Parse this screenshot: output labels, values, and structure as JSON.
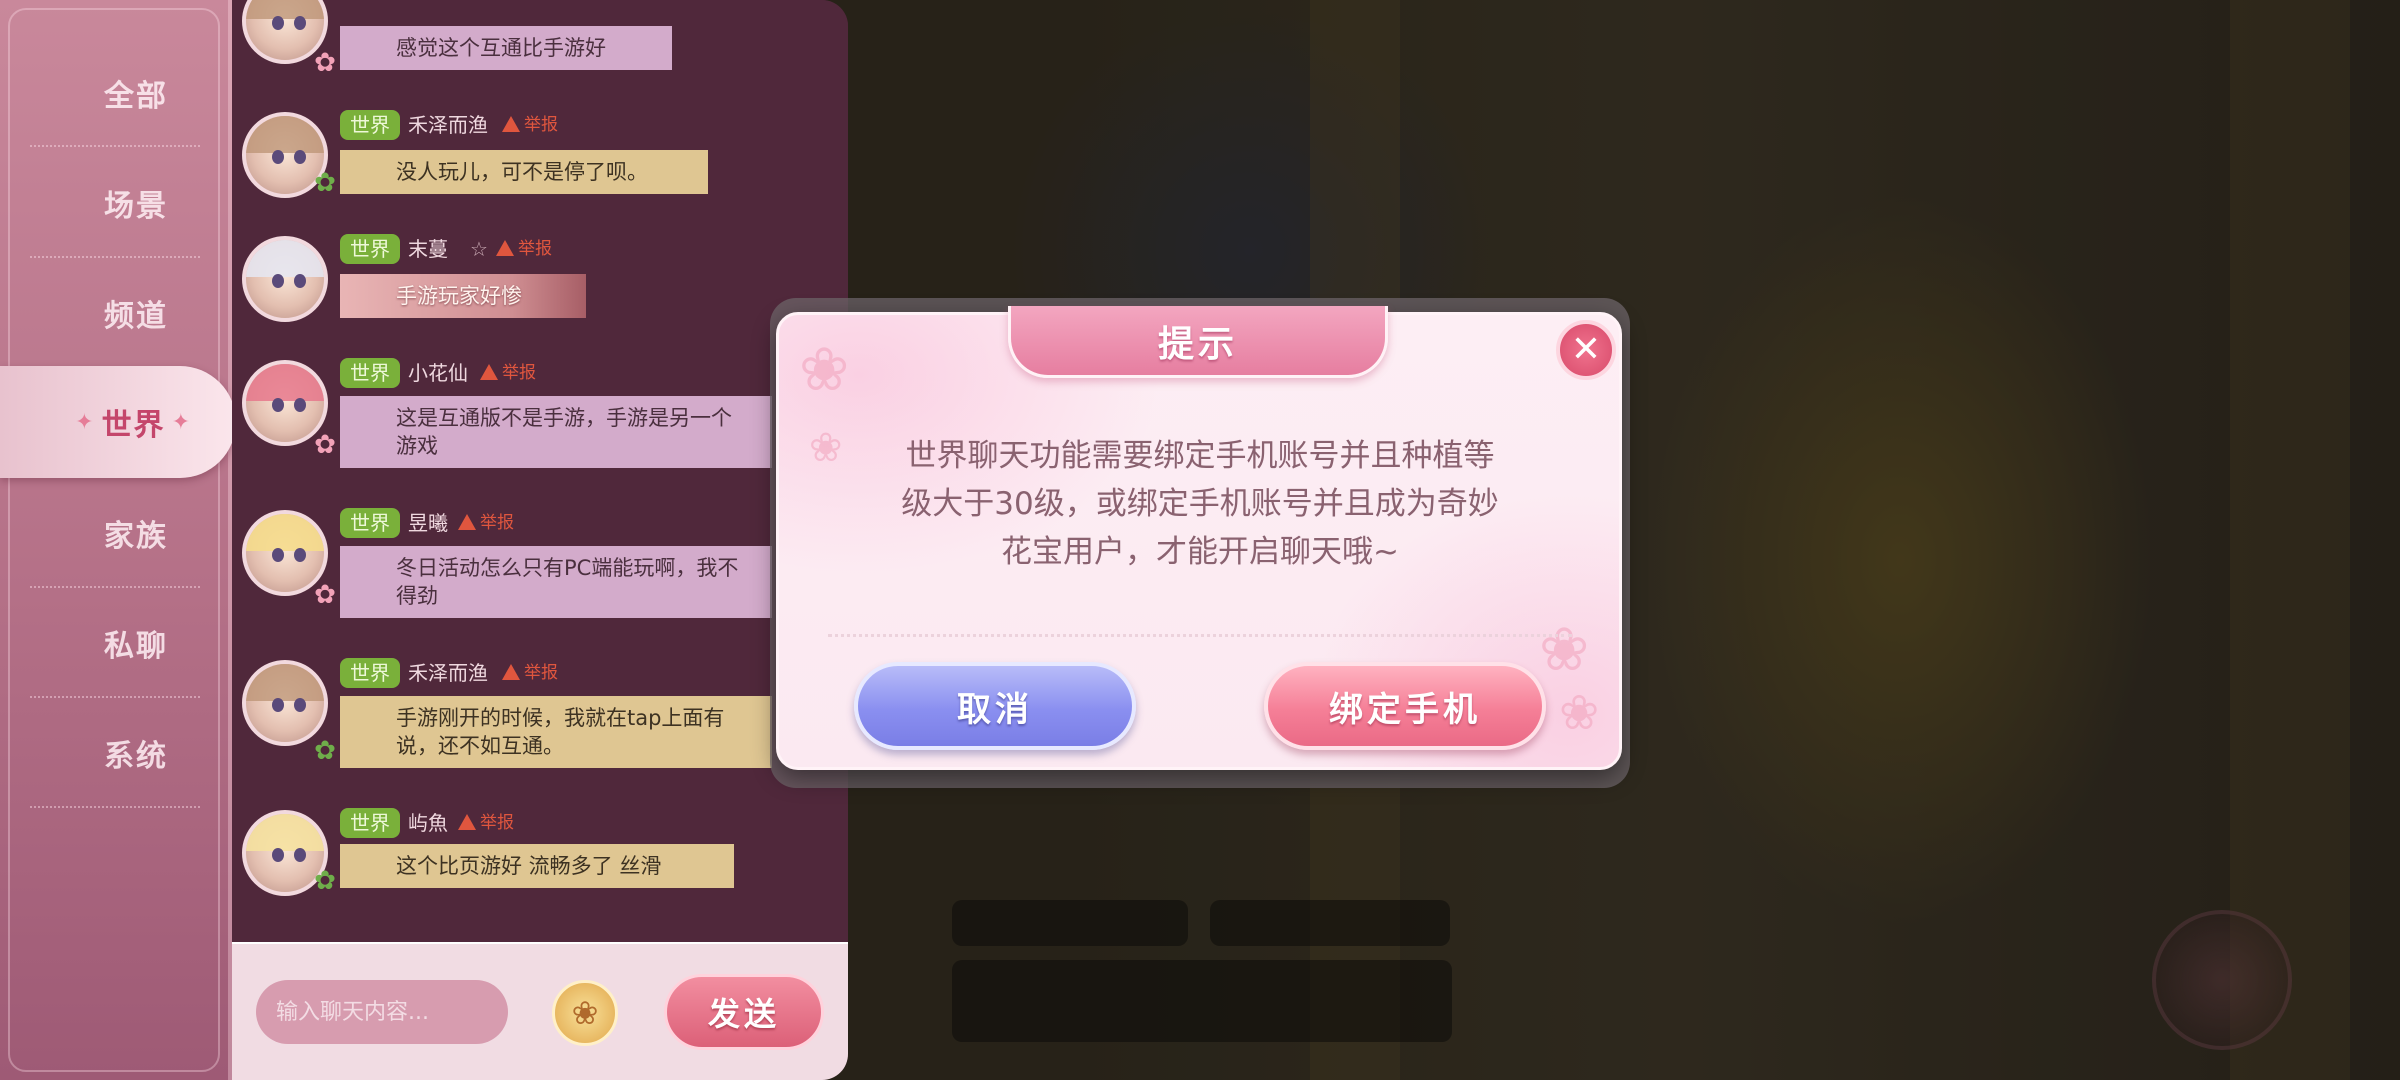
{
  "sidebar": {
    "items": [
      {
        "label": "全部"
      },
      {
        "label": "场景"
      },
      {
        "label": "频道"
      },
      {
        "label": "世界"
      },
      {
        "label": "家族"
      },
      {
        "label": "私聊"
      },
      {
        "label": "系统"
      }
    ],
    "active": "世界"
  },
  "chat": {
    "report_label": "举报",
    "channel_label": "世界",
    "messages": [
      {
        "username": "",
        "text": "感觉这个互通比手游好",
        "style": "pink"
      },
      {
        "username": "禾泽而渔",
        "text": "没人玩儿，可不是停了呗。",
        "style": "gold"
      },
      {
        "username": "末蔓",
        "text": "手游玩家好惨",
        "style": "rose",
        "star": "☆"
      },
      {
        "username": "小花仙",
        "text": "这是互通版不是手游，手游是另一个游戏",
        "style": "pink"
      },
      {
        "username": "昱曦",
        "text": "冬日活动怎么只有PC端能玩啊，我不得劲",
        "style": "pink"
      },
      {
        "username": "禾泽而渔",
        "text": "手游刚开的时候，我就在tap上面有说，还不如互通。",
        "style": "gold"
      },
      {
        "username": "屿魚",
        "text": "这个比页游好  流畅多了 丝滑",
        "style": "gold"
      }
    ]
  },
  "input_bar": {
    "placeholder": "输入聊天内容...",
    "send_label": "发送",
    "emoji_icon": "flower-emoji-icon"
  },
  "dialog": {
    "title": "提示",
    "message": "世界聊天功能需要绑定手机账号并且种植等级大于30级，或绑定手机账号并且成为奇妙花宝用户，才能开启聊天哦~",
    "cancel_label": "取消",
    "confirm_label": "绑定手机",
    "close_icon": "✕"
  },
  "colors": {
    "accent_pink": "#e67ea0",
    "cancel_blue": "#8a8ff0",
    "channel_green": "#7ab03a",
    "report_red": "#e0563e"
  }
}
